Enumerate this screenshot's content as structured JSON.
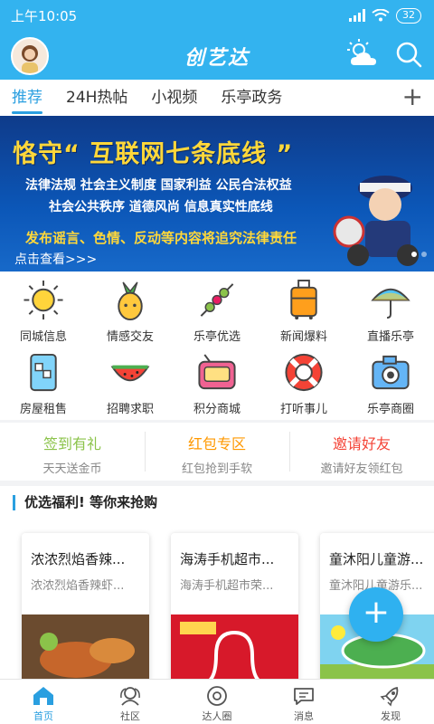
{
  "status_bar": {
    "time": "上午10:05",
    "battery": "32"
  },
  "header": {
    "title": "创艺达"
  },
  "tabs": [
    {
      "label": "推荐"
    },
    {
      "label": "24H热帖"
    },
    {
      "label": "小视频"
    },
    {
      "label": "乐亭政务"
    }
  ],
  "tab_add": "+",
  "banner": {
    "title": "恪守“ 互联网七条底线 ”",
    "line1": "法律法规 社会主义制度 国家利益 公民合法权益",
    "line2": "社会公共秩序 道德风尚 信息真实性底线",
    "warning": "发布谣言、色情、反动等内容将追究法律责任",
    "link": "点击查看>>>"
  },
  "grid": [
    {
      "label": "同城信息",
      "icon": "sun-icon"
    },
    {
      "label": "情感交友",
      "icon": "pineapple-icon"
    },
    {
      "label": "乐亭优选",
      "icon": "skewer-icon"
    },
    {
      "label": "新闻爆料",
      "icon": "suitcase-icon"
    },
    {
      "label": "直播乐亭",
      "icon": "umbrella-icon"
    },
    {
      "label": "房屋租售",
      "icon": "ice-drink-icon"
    },
    {
      "label": "招聘求职",
      "icon": "watermelon-icon"
    },
    {
      "label": "积分商城",
      "icon": "radio-icon"
    },
    {
      "label": "打听事儿",
      "icon": "lifebuoy-icon"
    },
    {
      "label": "乐亭商圈",
      "icon": "camera-icon"
    }
  ],
  "promos": [
    {
      "title": "签到有礼",
      "sub": "天天送金币",
      "color": "#8bc34a"
    },
    {
      "title": "红包专区",
      "sub": "红包抢到手软",
      "color": "#ff9800"
    },
    {
      "title": "邀请好友",
      "sub": "邀请好友领红包",
      "color": "#f44336"
    }
  ],
  "section": {
    "title": "优选福利! 等你来抢购",
    "cards": [
      {
        "title": "浓浓烈焰香辣...",
        "sub": "浓浓烈焰香辣虾..."
      },
      {
        "title": "海涛手机超市...",
        "sub": "海涛手机超市荣..."
      },
      {
        "title": "童沐阳儿童游...",
        "sub": "童沐阳儿童游乐..."
      }
    ]
  },
  "fab": "+",
  "bottom_nav": [
    {
      "label": "首页",
      "icon": "home-icon",
      "active": true
    },
    {
      "label": "社区",
      "icon": "community-icon",
      "active": false
    },
    {
      "label": "达人圈",
      "icon": "expert-circle-icon",
      "active": false
    },
    {
      "label": "消息",
      "icon": "message-icon",
      "active": false
    },
    {
      "label": "发现",
      "icon": "rocket-icon",
      "active": false
    }
  ],
  "colors": {
    "primary": "#33b3ef",
    "accent": "#2a9fe0",
    "banner": "#0c57b8"
  }
}
